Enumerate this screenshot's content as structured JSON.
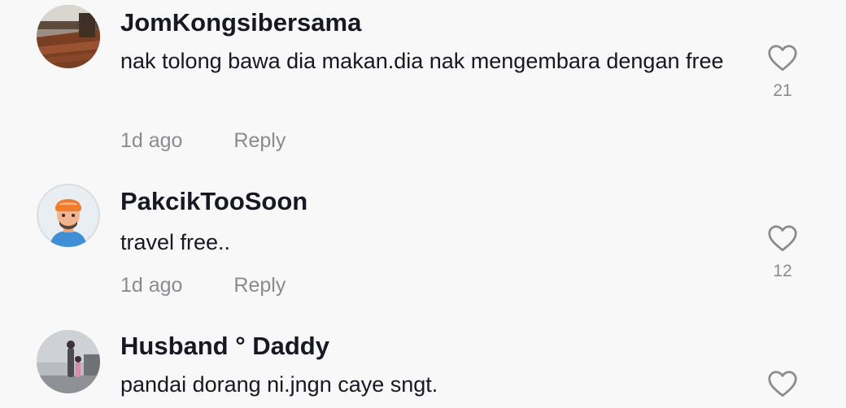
{
  "comments": [
    {
      "username": "JomKongsibersama",
      "text": "nak tolong bawa dia makan.dia nak mengembara dengan free",
      "time": "1d ago",
      "reply_label": "Reply",
      "likes": "21"
    },
    {
      "username": "PakcikTooSoon",
      "text": "travel free..",
      "time": "1d ago",
      "reply_label": "Reply",
      "likes": "12"
    },
    {
      "username": "Husband ° Daddy",
      "text": "pandai dorang ni.jngn caye sngt."
    }
  ],
  "colors": {
    "background": "#f8f8f8",
    "username": "#161823",
    "secondary": "#8a8b91"
  }
}
